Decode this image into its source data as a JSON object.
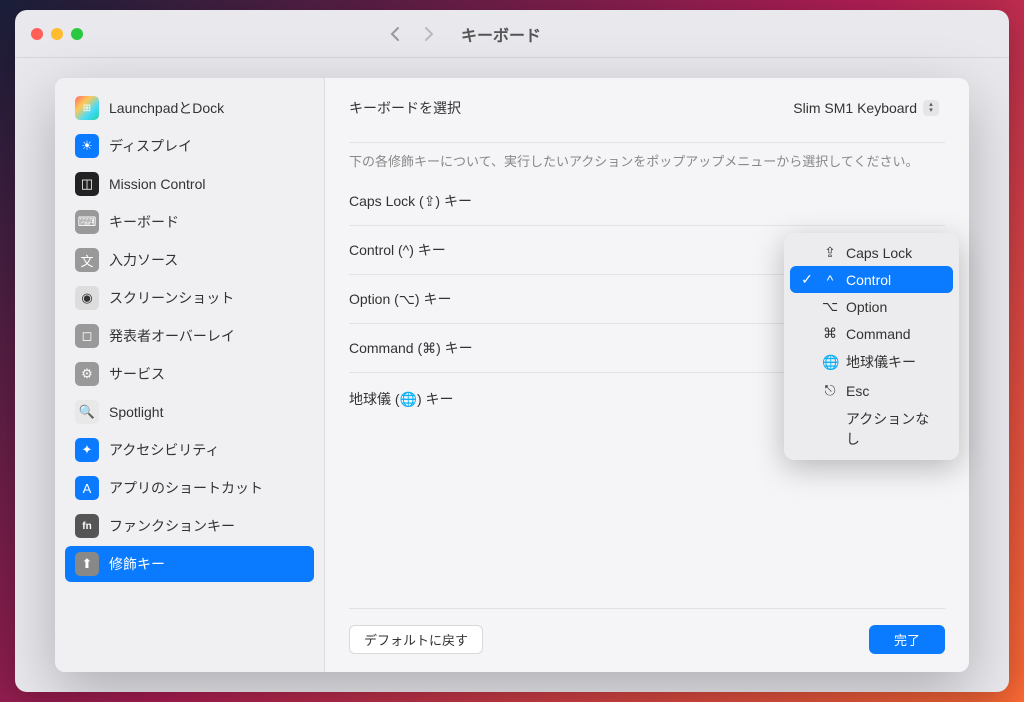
{
  "window": {
    "title": "キーボード"
  },
  "sidebar": {
    "items": [
      {
        "label": "LaunchpadとDock",
        "icon": "launchpad"
      },
      {
        "label": "ディスプレイ",
        "icon": "display"
      },
      {
        "label": "Mission Control",
        "icon": "mission"
      },
      {
        "label": "キーボード",
        "icon": "keyboard"
      },
      {
        "label": "入力ソース",
        "icon": "input"
      },
      {
        "label": "スクリーンショット",
        "icon": "screenshot"
      },
      {
        "label": "発表者オーバーレイ",
        "icon": "presenter"
      },
      {
        "label": "サービス",
        "icon": "services"
      },
      {
        "label": "Spotlight",
        "icon": "spotlight"
      },
      {
        "label": "アクセシビリティ",
        "icon": "accessibility"
      },
      {
        "label": "アプリのショートカット",
        "icon": "appshortcut"
      },
      {
        "label": "ファンクションキー",
        "icon": "function"
      },
      {
        "label": "修飾キー",
        "icon": "modifier",
        "selected": true
      }
    ]
  },
  "content": {
    "select_keyboard_label": "キーボードを選択",
    "selected_keyboard": "Slim SM1 Keyboard",
    "help_text": "下の各修飾キーについて、実行したいアクションをポップアップメニューから選択してください。",
    "rows": [
      {
        "label": "Caps Lock (⇪) キー"
      },
      {
        "label": "Control (^) キー"
      },
      {
        "label": "Option (⌥) キー"
      },
      {
        "label": "Command (⌘) キー"
      },
      {
        "label": "地球儀 (🌐) キー",
        "value": "🌐 地球儀キー"
      }
    ],
    "reset_button": "デフォルトに戻す",
    "done_button": "完了"
  },
  "popup": {
    "items": [
      {
        "icon": "⇪",
        "label": "Caps Lock"
      },
      {
        "icon": "^",
        "label": "Control",
        "selected": true
      },
      {
        "icon": "⌥",
        "label": "Option"
      },
      {
        "icon": "⌘",
        "label": "Command"
      },
      {
        "icon": "🌐",
        "label": "地球儀キー"
      },
      {
        "icon": "⎋",
        "label": "Esc"
      },
      {
        "icon": "",
        "label": "アクションなし"
      }
    ]
  }
}
